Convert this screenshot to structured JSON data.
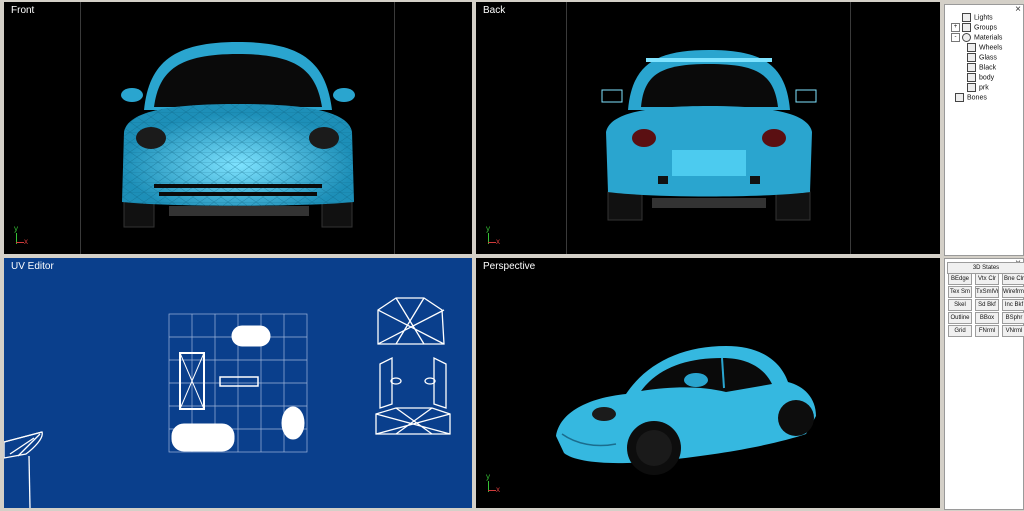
{
  "viewports": {
    "front": {
      "title": "Front"
    },
    "back": {
      "title": "Back"
    },
    "uv": {
      "title": "UV Editor"
    },
    "perspective": {
      "title": "Perspective"
    }
  },
  "axis": {
    "y": "y",
    "x": "x"
  },
  "scene_tree": {
    "items": [
      {
        "label": "Lights",
        "icon": "light-icon",
        "expander": ""
      },
      {
        "label": "Groups",
        "icon": "group-icon",
        "expander": "+"
      },
      {
        "label": "Materials",
        "icon": "material-icon",
        "expander": "-"
      },
      {
        "label": "Wheels",
        "icon": "texture-icon",
        "expander": ""
      },
      {
        "label": "Glass",
        "icon": "material-swatch-icon",
        "expander": ""
      },
      {
        "label": "Black",
        "icon": "material-swatch-icon",
        "expander": ""
      },
      {
        "label": "body",
        "icon": "material-swatch-icon",
        "expander": ""
      },
      {
        "label": "prk",
        "icon": "material-swatch-icon",
        "expander": ""
      },
      {
        "label": "Bones",
        "icon": "bone-icon",
        "expander": ""
      }
    ],
    "close_glyph": "×"
  },
  "states_panel": {
    "header": "3D States",
    "close_glyph": "×",
    "buttons": [
      "BEdge",
      "Vtx Clr",
      "Bne Clr",
      "Tex Sm",
      "TxSmlVr",
      "Wirefrme",
      "Skel",
      "Sd Bkf",
      "Inc Bkf",
      "Outline",
      "BBox",
      "BSphr",
      "Grid",
      "FNrml",
      "VNrml"
    ]
  },
  "colors": {
    "car_body": "#35b8e0",
    "uv_background": "#0a3f8c",
    "viewport_background": "#000000",
    "wire": "#ffffff"
  }
}
